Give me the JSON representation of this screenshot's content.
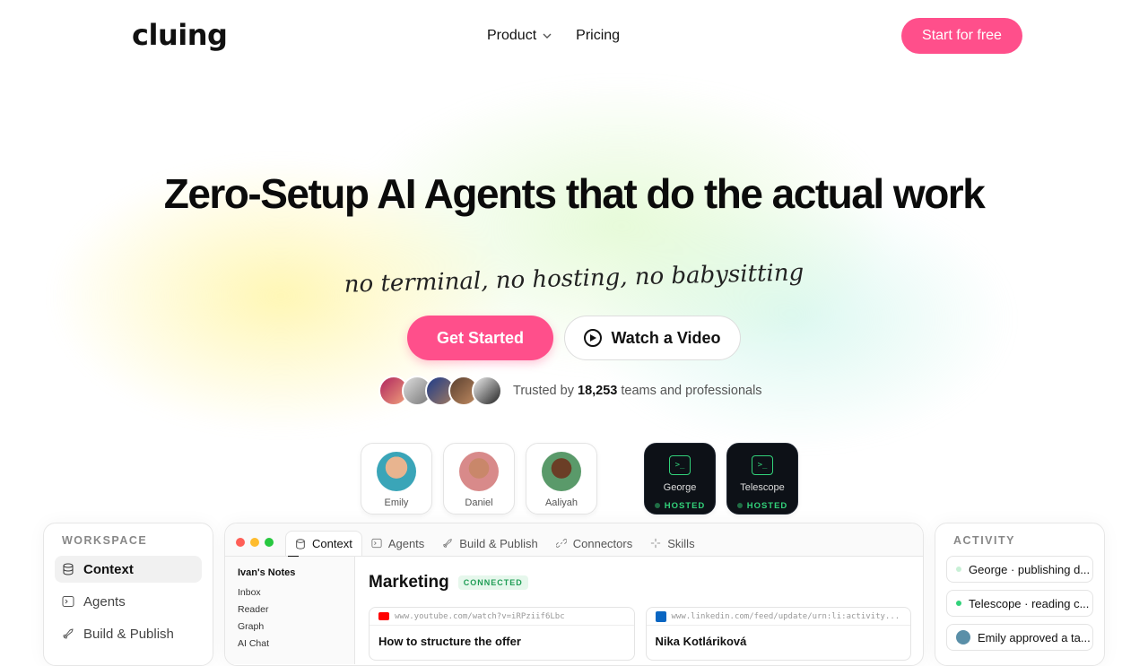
{
  "header": {
    "logo": "cluing",
    "nav": [
      {
        "label": "Product"
      },
      {
        "label": "Pricing"
      }
    ],
    "cta": "Start for free"
  },
  "hero": {
    "title": "Zero-Setup AI Agents that do the actual work",
    "subtitle": "no terminal, no hosting, no babysitting",
    "primary": "Get Started",
    "secondary": "Watch a Video",
    "trust_prefix": "Trusted by",
    "trust_count": "18,253",
    "trust_suffix": "teams and professionals"
  },
  "agents": [
    {
      "name": "Emily"
    },
    {
      "name": "Daniel"
    },
    {
      "name": "Aaliyah"
    },
    {
      "name": "George",
      "status": "HOSTED"
    },
    {
      "name": "Telescope",
      "status": "HOSTED"
    }
  ],
  "workspace": {
    "title": "WORKSPACE",
    "items": [
      "Context",
      "Agents",
      "Build & Publish"
    ]
  },
  "app": {
    "tabs": [
      "Context",
      "Agents",
      "Build & Publish",
      "Connectors",
      "Skills"
    ],
    "notes": {
      "title": "Ivan's Notes",
      "items": [
        "Inbox",
        "Reader",
        "Graph",
        "AI Chat"
      ]
    },
    "heading": "Marketing",
    "badge": "CONNECTED",
    "cards": [
      {
        "url": "www.youtube.com/watch?v=iRPziif6Lbc",
        "title": "How to structure the offer"
      },
      {
        "url": "www.linkedin.com/feed/update/urn:li:activity...",
        "title": "Nika Kotláriková"
      }
    ]
  },
  "activity": {
    "title": "ACTIVITY",
    "items": [
      "George · publishing d...",
      "Telescope · reading c...",
      "Emily approved a ta..."
    ]
  },
  "colors": {
    "accent": "#ff4f8b",
    "hosted": "#32d27a"
  }
}
